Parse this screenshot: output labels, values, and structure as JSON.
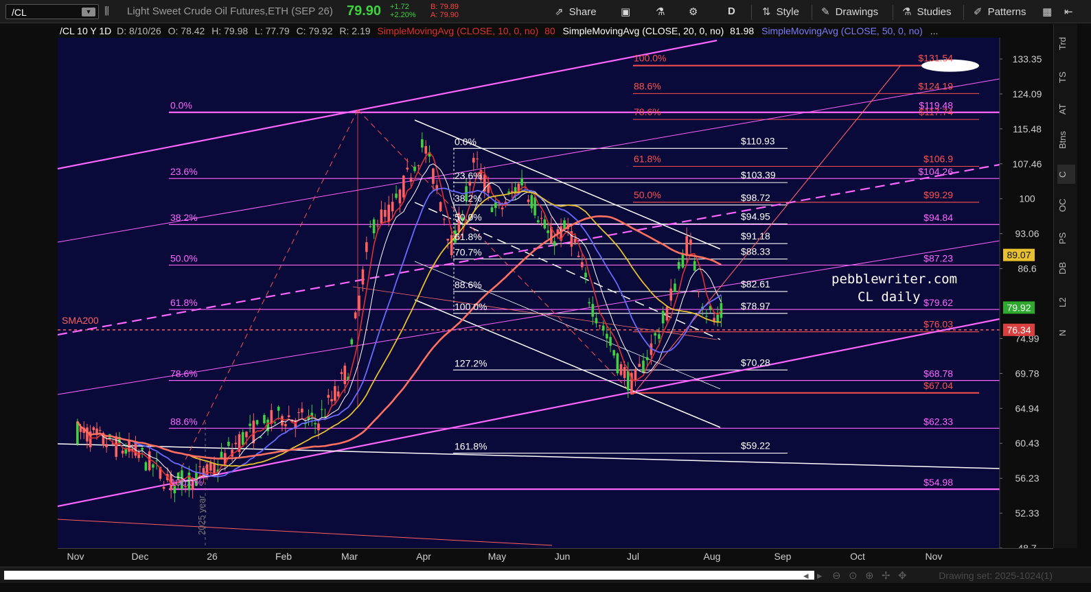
{
  "toolbar": {
    "symbol": "/CL",
    "description": "Light Sweet Crude Oil Futures,ETH (SEP 26)",
    "last": "79.90",
    "change": "+1.72",
    "change_pct": "+2.20%",
    "bid": "B: 79.89",
    "ask": "A: 79.90",
    "share_label": "Share",
    "aggregation_label": "D",
    "style_label": "Style",
    "drawings_label": "Drawings",
    "studies_label": "Studies",
    "patterns_label": "Patterns"
  },
  "header": {
    "symbol_period": "/CL 10 Y 1D",
    "date": "D: 8/10/26",
    "open": "O: 78.42",
    "high": "H: 79.98",
    "low": "L: 77.79",
    "close": "C: 79.92",
    "range": "R: 2.19",
    "sma10_label": "SimpleMovingAvg (CLOSE, 10, 0, no)",
    "sma10_value": "80",
    "sma20_label": "SimpleMovingAvg (CLOSE, 20, 0, no)",
    "sma20_value": "81.98",
    "sma50_label": "SimpleMovingAvg (CLOSE, 50, 0, no)",
    "more": "..."
  },
  "rail": {
    "items": [
      "Trd",
      "TS",
      "AT",
      "Btns",
      "C",
      "OC",
      "PS",
      "DB",
      "L2",
      "N"
    ]
  },
  "bottombar": {
    "drawing_set": "Drawing set: 2025-1024(1)"
  },
  "colors": {
    "background": "#0a0a3a",
    "up_candle": "#3fd13f",
    "down_candle": "#ff6060",
    "sma10": "#e03030",
    "sma20": "#ffffff",
    "sma50": "#6a6aff",
    "sma100": "#e8c030",
    "sma200": "#ff7060",
    "magenta": "#ff66ff",
    "white": "#ffffff",
    "red_level": "#ff5050"
  },
  "chart_data": {
    "type": "candlestick",
    "xlabels": [
      "Nov",
      "Dec",
      "26",
      "Feb",
      "Mar",
      "Apr",
      "May",
      "Jun",
      "Jul",
      "Aug",
      "Sep",
      "Oct",
      "Nov"
    ],
    "price_axis_ticks": [
      "133.35",
      "124.09",
      "115.48",
      "107.46",
      "100",
      "93.06",
      "86.6",
      "74.99",
      "69.78",
      "64.94",
      "60.43",
      "56.23",
      "52.33",
      "48.7"
    ],
    "price_tags": [
      {
        "label": "89.07",
        "value": 89.07,
        "color": "#e8c030",
        "text": "#111"
      },
      {
        "label": "79.92",
        "value": 79.92,
        "color": "#2ea82e",
        "text": "#fff"
      },
      {
        "label": "76.34",
        "value": 76.34,
        "color": "#d94040",
        "text": "#fff"
      }
    ],
    "watermark": [
      "pebblewriter.com",
      "CL daily"
    ],
    "sma200_label": "SMA200",
    "vertical_annotation": "2025 year",
    "left_fib": [
      {
        "pct": "0.0%",
        "value": 119.48
      },
      {
        "pct": "23.6%",
        "value": 104.26
      },
      {
        "pct": "38.2%",
        "value": 94.84
      },
      {
        "pct": "50.0%",
        "value": 87.23
      },
      {
        "pct": "61.8%",
        "value": 79.62
      },
      {
        "pct": "78.6%",
        "value": 68.78
      },
      {
        "pct": "88.6%",
        "value": 62.33
      },
      {
        "pct": "100.0%",
        "value": 54.98
      }
    ],
    "mid_fib": [
      {
        "pct": "0.0%",
        "value": 110.93
      },
      {
        "pct": "23.6%",
        "value": 103.39
      },
      {
        "pct": "38.2%",
        "value": 98.72
      },
      {
        "pct": "50.0%",
        "value": 94.95
      },
      {
        "pct": "61.8%",
        "value": 91.18
      },
      {
        "pct": "70.7%",
        "value": 88.33
      },
      {
        "pct": "88.6%",
        "value": 82.61
      },
      {
        "pct": "100.0%",
        "value": 78.97
      },
      {
        "pct": "127.2%",
        "value": 70.28
      },
      {
        "pct": "161.8%",
        "value": 59.22
      }
    ],
    "red_fib": [
      {
        "pct": "100.0%",
        "value": 131.54
      },
      {
        "pct": "88.6%",
        "value": 124.19
      },
      {
        "pct": "78.6%",
        "value": 117.74
      },
      {
        "pct": "61.8%",
        "value": 106.9
      },
      {
        "pct": "50.0%",
        "value": 99.29
      },
      {
        "pct": "",
        "value": 76.03
      },
      {
        "pct": "",
        "value": 67.04
      }
    ]
  }
}
